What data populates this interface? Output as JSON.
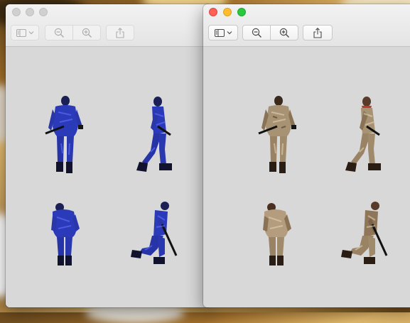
{
  "desktop": {
    "wallpaper": "warm-blurred-photo"
  },
  "windows": [
    {
      "id": "preview-left",
      "state": "inactive",
      "sprite_tint": "#2b3ab8",
      "toolbar": [
        "sidebar-icon",
        "chevron-down-icon",
        "zoom-out-icon",
        "zoom-in-icon",
        "share-icon"
      ],
      "sprites": [
        "soldier-back-standing",
        "soldier-side-walking",
        "soldier-back-crouched",
        "soldier-side-crouching-aiming"
      ]
    },
    {
      "id": "preview-right",
      "state": "active",
      "sprite_tint": "#8a7355",
      "toolbar": [
        "sidebar-icon",
        "chevron-down-icon",
        "zoom-out-icon",
        "zoom-in-icon",
        "share-icon"
      ],
      "sprites": [
        "soldier-back-standing",
        "soldier-side-walking",
        "soldier-back-crouched",
        "soldier-side-crouching-aiming"
      ]
    }
  ]
}
